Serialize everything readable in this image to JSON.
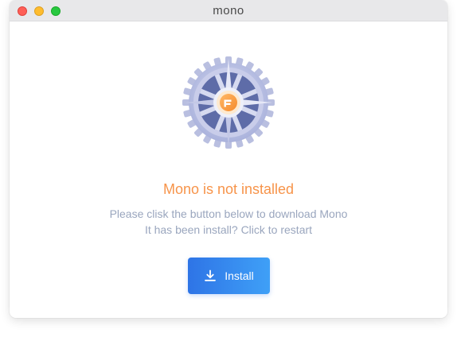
{
  "window": {
    "title": "mono",
    "controls": [
      "close",
      "minimize",
      "maximize"
    ]
  },
  "main": {
    "icon": "gear-with-mono-logo-icon",
    "headline": "Mono is not installed",
    "line1": "Please clisk the button below to download Mono",
    "line2": "It has been install? Click to restart",
    "install_button": {
      "icon": "download-icon",
      "label": "Install"
    }
  },
  "colors": {
    "headline": "#f7944a",
    "subtext": "#9aa6be",
    "button_start": "#2e74e6",
    "button_end": "#3fa0f7",
    "gear": "#b9bfe0",
    "gear_dark": "#5b6aa5",
    "logo": "#f7a24a"
  }
}
